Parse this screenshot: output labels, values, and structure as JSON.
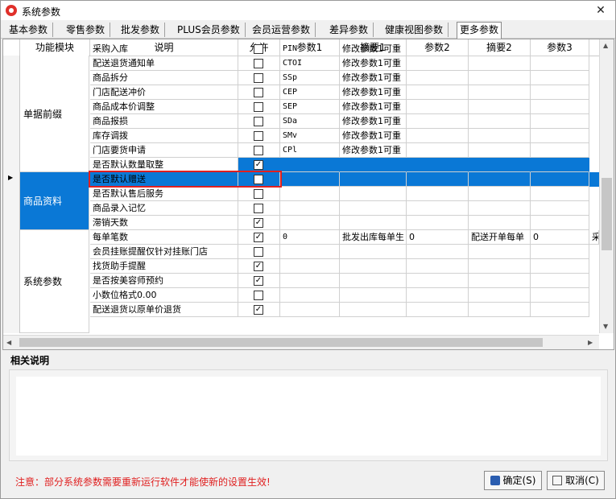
{
  "window": {
    "title": "系统参数",
    "close_glyph": "✕"
  },
  "tabs": [
    "基本参数",
    "零售参数",
    "批发参数",
    "PLUS会员参数",
    "会员运营参数",
    "差异参数",
    "健康视图参数",
    "更多参数"
  ],
  "active_tab": "更多参数",
  "grid": {
    "headers": [
      "功能模块",
      "说明",
      "允许",
      "参数1",
      "摘要1",
      "参数2",
      "摘要2",
      "参数3"
    ],
    "groups": [
      {
        "label": "单据前缀"
      },
      {
        "label": "商品资料"
      },
      {
        "label": "系统参数"
      }
    ],
    "rows": [
      {
        "desc": "采购入库",
        "checked": false,
        "p1": "PIN",
        "s1": "修改参数1可重",
        "p2": "",
        "s2": "",
        "p3": ""
      },
      {
        "desc": "配送退货通知单",
        "checked": false,
        "p1": "CTOI",
        "s1": "修改参数1可重",
        "p2": "",
        "s2": "",
        "p3": ""
      },
      {
        "desc": "商品拆分",
        "checked": false,
        "p1": "SSp",
        "s1": "修改参数1可重",
        "p2": "",
        "s2": "",
        "p3": ""
      },
      {
        "desc": "门店配送冲价",
        "checked": false,
        "p1": "CEP",
        "s1": "修改参数1可重",
        "p2": "",
        "s2": "",
        "p3": ""
      },
      {
        "desc": "商品成本价调整",
        "checked": false,
        "p1": "SEP",
        "s1": "修改参数1可重",
        "p2": "",
        "s2": "",
        "p3": ""
      },
      {
        "desc": "商品报损",
        "checked": false,
        "p1": "SDa",
        "s1": "修改参数1可重",
        "p2": "",
        "s2": "",
        "p3": ""
      },
      {
        "desc": "库存调拨",
        "checked": false,
        "p1": "SMv",
        "s1": "修改参数1可重",
        "p2": "",
        "s2": "",
        "p3": ""
      },
      {
        "desc": "门店要货申请",
        "checked": false,
        "p1": "CPl",
        "s1": "修改参数1可重",
        "p2": "",
        "s2": "",
        "p3": ""
      },
      {
        "desc": "是否默认数量取整",
        "checked": true,
        "p1": "",
        "s1": "",
        "p2": "",
        "s2": "",
        "p3": ""
      },
      {
        "desc": "是否默认赠送",
        "checked": false,
        "p1": "",
        "s1": "",
        "p2": "",
        "s2": "",
        "p3": ""
      },
      {
        "desc": "是否默认售后服务",
        "checked": false,
        "p1": "",
        "s1": "",
        "p2": "",
        "s2": "",
        "p3": ""
      },
      {
        "desc": "商品录入记忆",
        "checked": false,
        "p1": "",
        "s1": "",
        "p2": "",
        "s2": "",
        "p3": ""
      },
      {
        "desc": "滞销天数",
        "checked": true,
        "p1": "",
        "s1": "",
        "p2": "",
        "s2": "",
        "p3": ""
      },
      {
        "desc": "每单笔数",
        "checked": true,
        "p1": "0",
        "s1": "批发出库每单生",
        "p2": "0",
        "s2": "配送开单每单",
        "p3": "0"
      },
      {
        "desc": "会员挂账提醒仅针对挂账门店",
        "checked": false,
        "p1": "",
        "s1": "",
        "p2": "",
        "s2": "",
        "p3": ""
      },
      {
        "desc": "找货助手提醒",
        "checked": true,
        "p1": "",
        "s1": "",
        "p2": "",
        "s2": "",
        "p3": ""
      },
      {
        "desc": "是否按美容师预约",
        "checked": true,
        "p1": "",
        "s1": "",
        "p2": "",
        "s2": "",
        "p3": ""
      },
      {
        "desc": "小数位格式0.00",
        "checked": false,
        "p1": "",
        "s1": "",
        "p2": "",
        "s2": "",
        "p3": ""
      },
      {
        "desc": "配送退货以原单价退货",
        "checked": true,
        "p1": "",
        "s1": "",
        "p2": "",
        "s2": "",
        "p3": ""
      }
    ],
    "extra_s3_fragment": "采",
    "current_row_marker": "▶"
  },
  "description": {
    "title": "相关说明",
    "text": ""
  },
  "footer": {
    "notice": "注意：部分系统参数需要重新运行软件才能使新的设置生效!",
    "ok_label": "确定(S)",
    "cancel_label": "取消(C)"
  },
  "colors": {
    "selection": "#0a78d6",
    "notice": "#e02020",
    "highlight_box": "#e02020"
  }
}
